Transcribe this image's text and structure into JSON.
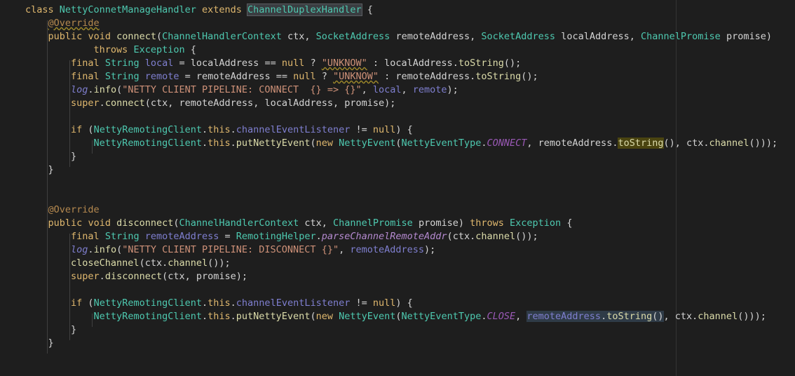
{
  "editor": {
    "lines": [
      "class NettyConnetManageHandler extends ChannelDuplexHandler {",
      "    @Override",
      "    public void connect(ChannelHandlerContext ctx, SocketAddress remoteAddress, SocketAddress localAddress, ChannelPromise promise)",
      "            throws Exception {",
      "        final String local = localAddress == null ? \"UNKNOW\" : localAddress.toString();",
      "        final String remote = remoteAddress == null ? \"UNKNOW\" : remoteAddress.toString();",
      "        log.info(\"NETTY CLIENT PIPELINE: CONNECT  {} => {}\", local, remote);",
      "        super.connect(ctx, remoteAddress, localAddress, promise);",
      "",
      "        if (NettyRemotingClient.this.channelEventListener != null) {",
      "            NettyRemotingClient.this.putNettyEvent(new NettyEvent(NettyEventType.CONNECT, remoteAddress.toString(), ctx.channel()));",
      "        }",
      "    }",
      "",
      "",
      "    @Override",
      "    public void disconnect(ChannelHandlerContext ctx, ChannelPromise promise) throws Exception {",
      "        final String remoteAddress = RemotingHelper.parseChannelRemoteAddr(ctx.channel());",
      "        log.info(\"NETTY CLIENT PIPELINE: DISCONNECT {}\", remoteAddress);",
      "        closeChannel(ctx.channel());",
      "        super.disconnect(ctx, promise);",
      "",
      "        if (NettyRemotingClient.this.channelEventListener != null) {",
      "            NettyRemotingClient.this.putNettyEvent(new NettyEvent(NettyEventType.CLOSE, remoteAddress.toString(), ctx.channel()));",
      "        }",
      "    }",
      ""
    ],
    "tokens": {
      "kw_class": "class",
      "cls_name": "NettyConnetManageHandler",
      "kw_extends": "extends",
      "super_type": "ChannelDuplexHandler",
      "brace_open": "{",
      "annotation": "@Override",
      "kw_public": "public",
      "kw_void": "void",
      "kw_throws": "throws",
      "kw_final": "final",
      "kw_null": "null",
      "kw_if": "if",
      "kw_this": "this",
      "kw_super": "super",
      "kw_new": "new",
      "t_chc": "ChannelHandlerContext",
      "t_sa": "SocketAddress",
      "t_cp": "ChannelPromise",
      "t_ex": "Exception",
      "t_string": "String",
      "t_nrc": "NettyRemotingClient",
      "t_ne": "NettyEvent",
      "t_net": "NettyEventType",
      "t_rh": "RemotingHelper",
      "fn_connect": "connect",
      "fn_disconnect": "disconnect",
      "fn_tostring": "toString",
      "fn_info": "info",
      "fn_put": "putNettyEvent",
      "fn_channel": "channel",
      "fn_close": "closeChannel",
      "fn_parse": "parseChannelRemoteAddr",
      "v_ctx": "ctx",
      "v_remote_addr": "remoteAddress",
      "v_local_addr": "localAddress",
      "v_promise": "promise",
      "v_local": "local",
      "v_remote": "remote",
      "v_log": "log",
      "f_listener": "channelEventListener",
      "e_connect": "CONNECT",
      "e_close": "CLOSE",
      "s_unknow": "\"UNKNOW\"",
      "s_connect_msg": "\"NETTY CLIENT PIPELINE: CONNECT  {} => {}\"",
      "s_disconnect_msg": "\"NETTY CLIENT PIPELINE: DISCONNECT {}\""
    }
  }
}
